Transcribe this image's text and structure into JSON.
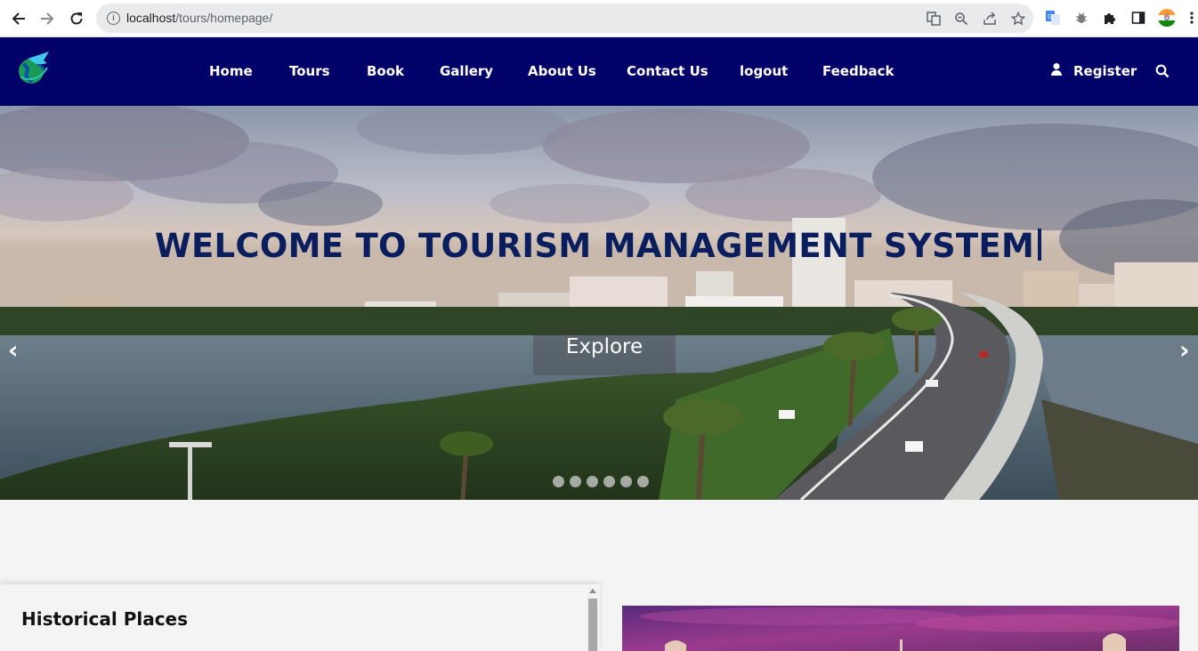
{
  "browser": {
    "url_host": "localhost",
    "url_path": "/tours/homepage/"
  },
  "navbar": {
    "items": [
      {
        "label": "Home"
      },
      {
        "label": "Tours"
      },
      {
        "label": "Book"
      },
      {
        "label": "Gallery"
      },
      {
        "label": "About Us"
      },
      {
        "label": "Contact Us"
      },
      {
        "label": "logout"
      },
      {
        "label": "Feedback"
      }
    ],
    "register_label": "Register"
  },
  "hero": {
    "title": "WELCOME TO TOURISM MANAGEMENT SYSTEM",
    "explore_label": "Explore",
    "prev_label": "‹",
    "next_label": "›",
    "slide_count": 6
  },
  "section": {
    "historical_title": "Historical Places"
  },
  "colors": {
    "header_bg": "#02016a",
    "title_color": "#0a1e5e"
  }
}
